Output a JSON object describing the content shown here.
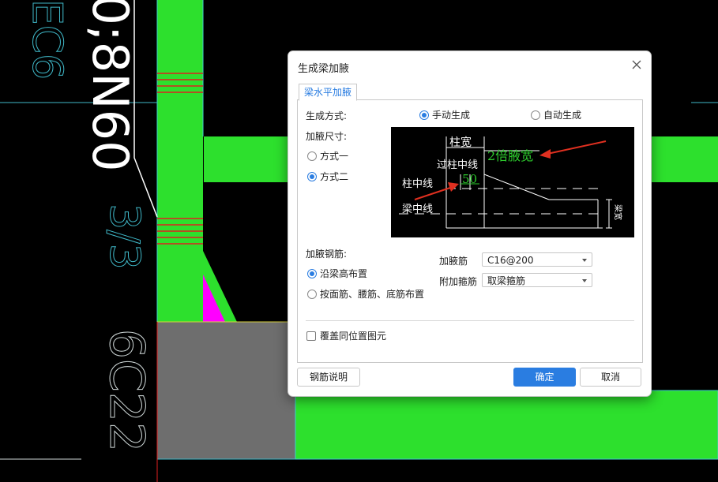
{
  "cad": {
    "left_text_1": "EC6",
    "left_text_2": "0;8N60",
    "left_text_3": "3/3",
    "left_text_4": "6C22"
  },
  "dialog": {
    "title": "生成梁加腋",
    "tab": "梁水平加腋",
    "gen_mode_label": "生成方式:",
    "gen_manual": "手动生成",
    "gen_auto": "自动生成",
    "size_label": "加腋尺寸:",
    "size_opt1": "方式一",
    "size_opt2": "方式二",
    "rebar_label": "加腋钢筋:",
    "rebar_opt1": "沿梁高布置",
    "rebar_opt2": "按面筋、腰筋、底筋布置",
    "haunch_bar_label": "加腋筋",
    "haunch_bar_value": "C16@200",
    "stirrup_label": "附加箍筋",
    "stirrup_value": "取梁箍筋",
    "override_label": "覆盖同位置图元",
    "btn_rebar_info": "钢筋说明",
    "btn_ok": "确定",
    "btn_cancel": "取消",
    "selected_gen_mode": "手动生成",
    "selected_size": "方式二",
    "selected_rebar": "沿梁高布置",
    "override_checked": false
  },
  "diagram": {
    "col_width": "柱宽",
    "double_width": "2倍腋宽",
    "past_center": "过柱中线",
    "value_50": "50",
    "col_center": "柱中线",
    "beam_center": "梁中线",
    "beam_width": "梁宽"
  },
  "colors": {
    "cad_green": "#2de02d",
    "cad_magenta": "#ff00ff",
    "cad_gray": "#6e6e6e",
    "accent": "#2a7de1",
    "diagram_green": "#2dcc2d",
    "arrow_red": "#e03020"
  }
}
